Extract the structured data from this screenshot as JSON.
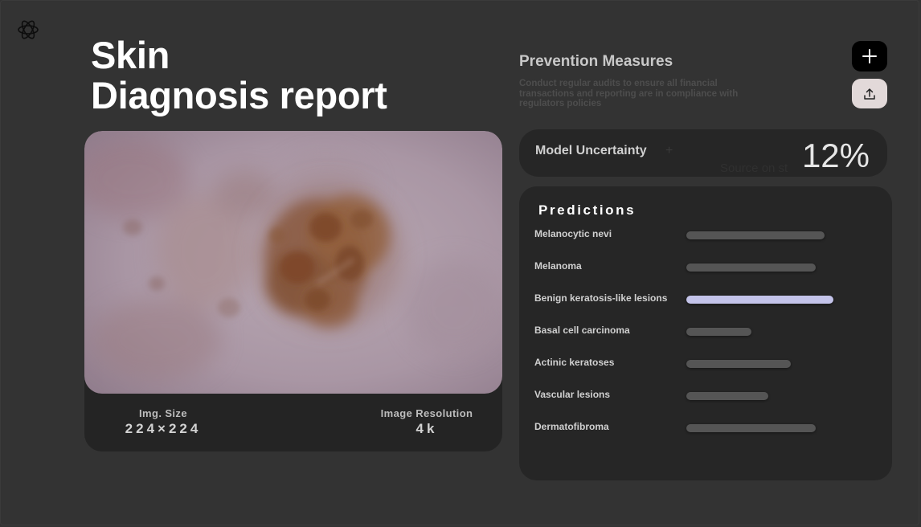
{
  "header": {
    "title_line1": "Skin",
    "title_line2": "Diagnosis report"
  },
  "image_card": {
    "size_label": "Img. Size",
    "size_value": "224×224",
    "resolution_label": "Image Resolution",
    "resolution_value": "4k"
  },
  "prevention": {
    "title": "Prevention Measures",
    "description": "Conduct regular audits to ensure all financial transactions and reporting are in compliance with regulators policies"
  },
  "uncertainty": {
    "label": "Model Uncertainty",
    "value": "12%",
    "ghost_plus": "+",
    "ghost_text": "Source on st"
  },
  "predictions": {
    "title": "Predictions",
    "highlight_color": "#c4c4ea",
    "bar_color": "#555555",
    "items": [
      {
        "label": "Melanocytic nevi",
        "score": 0.94,
        "highlight": false
      },
      {
        "label": "Melanoma",
        "score": 0.88,
        "highlight": false
      },
      {
        "label": "Benign keratosis-like lesions",
        "score": 1.0,
        "highlight": true
      },
      {
        "label": "Basal cell carcinoma",
        "score": 0.44,
        "highlight": false
      },
      {
        "label": "Actinic keratoses",
        "score": 0.71,
        "highlight": false
      },
      {
        "label": "Vascular lesions",
        "score": 0.56,
        "highlight": false
      },
      {
        "label": "Dermatofibroma",
        "score": 0.88,
        "highlight": false
      }
    ]
  },
  "icons": {
    "logo": "openai-logo-icon",
    "add": "plus-icon",
    "upload": "upload-icon"
  }
}
